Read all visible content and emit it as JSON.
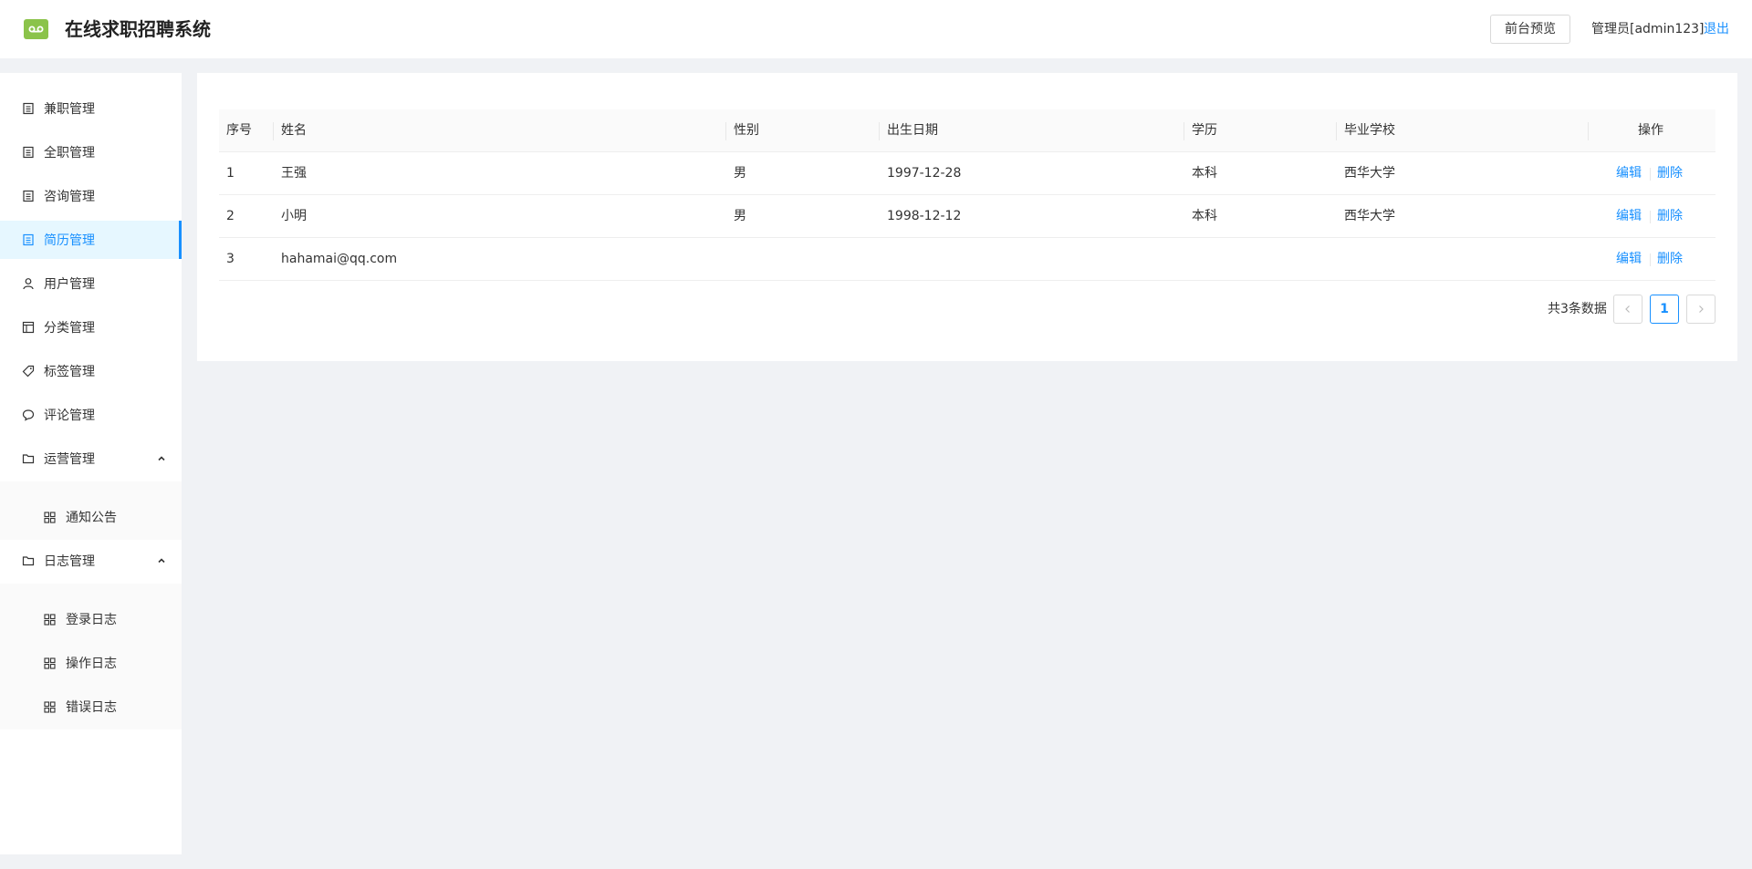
{
  "app": {
    "title": "在线求职招聘系统"
  },
  "header": {
    "preview_label": "前台预览",
    "admin_label": "管理员[admin123]",
    "logout_label": "退出"
  },
  "sidebar": {
    "items": [
      {
        "label": "兼职管理",
        "icon": "list-icon",
        "active": false
      },
      {
        "label": "全职管理",
        "icon": "list-icon",
        "active": false
      },
      {
        "label": "咨询管理",
        "icon": "list-icon",
        "active": false
      },
      {
        "label": "简历管理",
        "icon": "list-icon",
        "active": true
      },
      {
        "label": "用户管理",
        "icon": "user-icon",
        "active": false
      },
      {
        "label": "分类管理",
        "icon": "layout-icon",
        "active": false
      },
      {
        "label": "标签管理",
        "icon": "tag-icon",
        "active": false
      },
      {
        "label": "评论管理",
        "icon": "comment-icon",
        "active": false
      }
    ],
    "groups": [
      {
        "label": "运营管理",
        "icon": "folder-icon",
        "expanded": true,
        "children": [
          {
            "label": "通知公告",
            "icon": "grid-icon"
          }
        ]
      },
      {
        "label": "日志管理",
        "icon": "folder-icon",
        "expanded": true,
        "children": [
          {
            "label": "登录日志",
            "icon": "grid-icon"
          },
          {
            "label": "操作日志",
            "icon": "grid-icon"
          },
          {
            "label": "错误日志",
            "icon": "grid-icon"
          }
        ]
      }
    ]
  },
  "table": {
    "columns": [
      "序号",
      "姓名",
      "性别",
      "出生日期",
      "学历",
      "毕业学校",
      "操作"
    ],
    "rows": [
      {
        "index": "1",
        "name": "王强",
        "gender": "男",
        "birth": "1997-12-28",
        "education": "本科",
        "school": "西华大学"
      },
      {
        "index": "2",
        "name": "小明",
        "gender": "男",
        "birth": "1998-12-12",
        "education": "本科",
        "school": "西华大学"
      },
      {
        "index": "3",
        "name": "hahamai@qq.com",
        "gender": "",
        "birth": "",
        "education": "",
        "school": ""
      }
    ],
    "actions": {
      "edit": "编辑",
      "delete": "删除"
    }
  },
  "pagination": {
    "total_text": "共3条数据",
    "current_page": "1",
    "prev_icon": "chevron-left-icon",
    "next_icon": "chevron-right-icon"
  },
  "colors": {
    "accent": "#1890ff",
    "logo": "#8bc34a",
    "background": "#f0f2f5"
  }
}
